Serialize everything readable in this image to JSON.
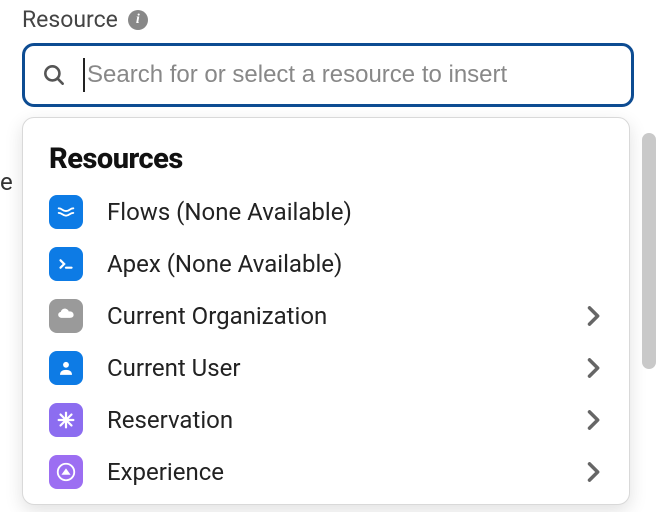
{
  "field": {
    "label": "Resource",
    "placeholder": "Search for or select a resource to insert",
    "value": ""
  },
  "dropdown": {
    "header": "Resources",
    "items": [
      {
        "label": "Flows (None Available)",
        "icon": "flows-icon",
        "bg": "bg-flows",
        "chevron": false
      },
      {
        "label": "Apex (None Available)",
        "icon": "apex-icon",
        "bg": "bg-apex",
        "chevron": false
      },
      {
        "label": "Current Organization",
        "icon": "org-icon",
        "bg": "bg-org",
        "chevron": true
      },
      {
        "label": "Current User",
        "icon": "user-icon",
        "bg": "bg-user",
        "chevron": true
      },
      {
        "label": "Reservation",
        "icon": "reservation-icon",
        "bg": "bg-reservation",
        "chevron": true
      },
      {
        "label": "Experience",
        "icon": "experience-icon",
        "bg": "bg-experience",
        "chevron": true
      }
    ]
  },
  "peek_text": "e",
  "colors": {
    "focus_border": "#0d4c92",
    "icon_blue": "#0d7be5",
    "icon_purple": "#8c6df0",
    "icon_gray": "#9a9a9a"
  }
}
